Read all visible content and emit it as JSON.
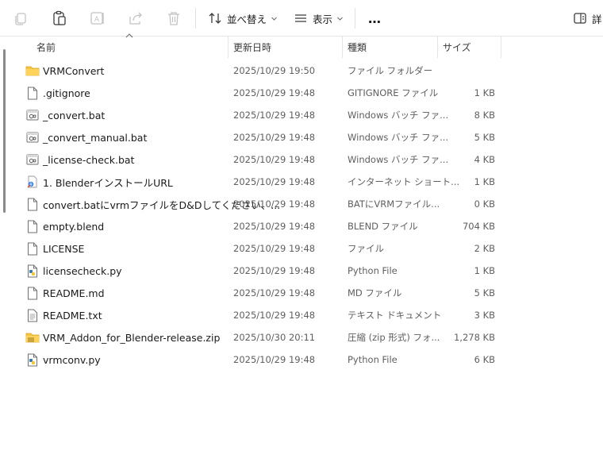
{
  "toolbar": {
    "sort_label": "並べ替え",
    "view_label": "表示",
    "more_label": "…",
    "details_label": "詳"
  },
  "columns": {
    "name": "名前",
    "date": "更新日時",
    "type": "種類",
    "size": "サイズ"
  },
  "files": [
    {
      "icon": "folder-icon",
      "name": "VRMConvert",
      "date": "2025/10/29 19:50",
      "type": "ファイル フォルダー",
      "size": ""
    },
    {
      "icon": "file-icon",
      "name": ".gitignore",
      "date": "2025/10/29 19:48",
      "type": "GITIGNORE ファイル",
      "size": "1 KB"
    },
    {
      "icon": "batch-file-icon",
      "name": "_convert.bat",
      "date": "2025/10/29 19:48",
      "type": "Windows バッチ ファ...",
      "size": "8 KB"
    },
    {
      "icon": "batch-file-icon",
      "name": "_convert_manual.bat",
      "date": "2025/10/29 19:48",
      "type": "Windows バッチ ファ...",
      "size": "5 KB"
    },
    {
      "icon": "batch-file-icon",
      "name": "_license-check.bat",
      "date": "2025/10/29 19:48",
      "type": "Windows バッチ ファ...",
      "size": "4 KB"
    },
    {
      "icon": "internet-shortcut-icon",
      "name": "1. BlenderインストールURL",
      "date": "2025/10/29 19:48",
      "type": "インターネット ショート...",
      "size": "1 KB"
    },
    {
      "icon": "file-icon",
      "name": "convert.batにvrmファイルをD&Dしてください、...",
      "date": "2025/10/29 19:48",
      "type": "BATにVRMファイル...",
      "size": "0 KB"
    },
    {
      "icon": "file-icon",
      "name": "empty.blend",
      "date": "2025/10/29 19:48",
      "type": "BLEND ファイル",
      "size": "704 KB"
    },
    {
      "icon": "file-icon",
      "name": "LICENSE",
      "date": "2025/10/29 19:48",
      "type": "ファイル",
      "size": "2 KB"
    },
    {
      "icon": "python-file-icon",
      "name": "licensecheck.py",
      "date": "2025/10/29 19:48",
      "type": "Python File",
      "size": "1 KB"
    },
    {
      "icon": "file-icon",
      "name": "README.md",
      "date": "2025/10/29 19:48",
      "type": "MD ファイル",
      "size": "5 KB"
    },
    {
      "icon": "text-file-icon",
      "name": "README.txt",
      "date": "2025/10/29 19:48",
      "type": "テキスト ドキュメント",
      "size": "3 KB"
    },
    {
      "icon": "zip-folder-icon",
      "name": "VRM_Addon_for_Blender-release.zip",
      "date": "2025/10/30 20:11",
      "type": "圧縮 (zip 形式) フォ...",
      "size": "1,278 KB"
    },
    {
      "icon": "python-file-icon",
      "name": "vrmconv.py",
      "date": "2025/10/29 19:48",
      "type": "Python File",
      "size": "6 KB"
    }
  ]
}
